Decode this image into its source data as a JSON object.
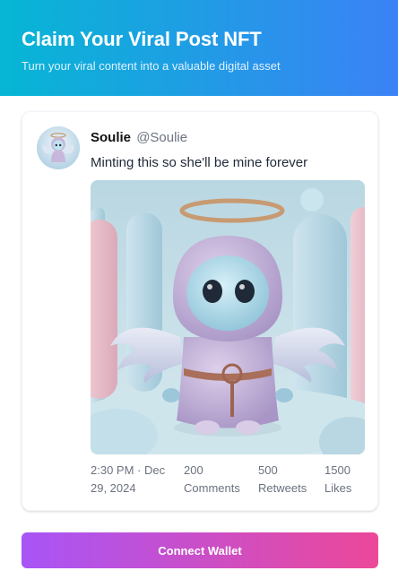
{
  "header": {
    "title": "Claim Your Viral Post NFT",
    "subtitle": "Turn your viral content into a valuable digital asset",
    "gradient_start": "#06b6d4",
    "gradient_end": "#3b82f6"
  },
  "post": {
    "display_name": "Soulie",
    "handle": "@Soulie",
    "text": "Minting this so she'll be mine forever",
    "avatar_icon": "angel-character-avatar",
    "image_icon": "angel-character-3d-render",
    "time": "2:30 PM · Dec 29, 2024",
    "comments_count": "200",
    "comments_label": "Comments",
    "retweets_count": "500",
    "retweets_label": "Retweets",
    "likes_count": "1500",
    "likes_label": "Likes"
  },
  "actions": {
    "connect_wallet_label": "Connect Wallet",
    "button_gradient_start": "#a855f7",
    "button_gradient_end": "#ec4899"
  }
}
